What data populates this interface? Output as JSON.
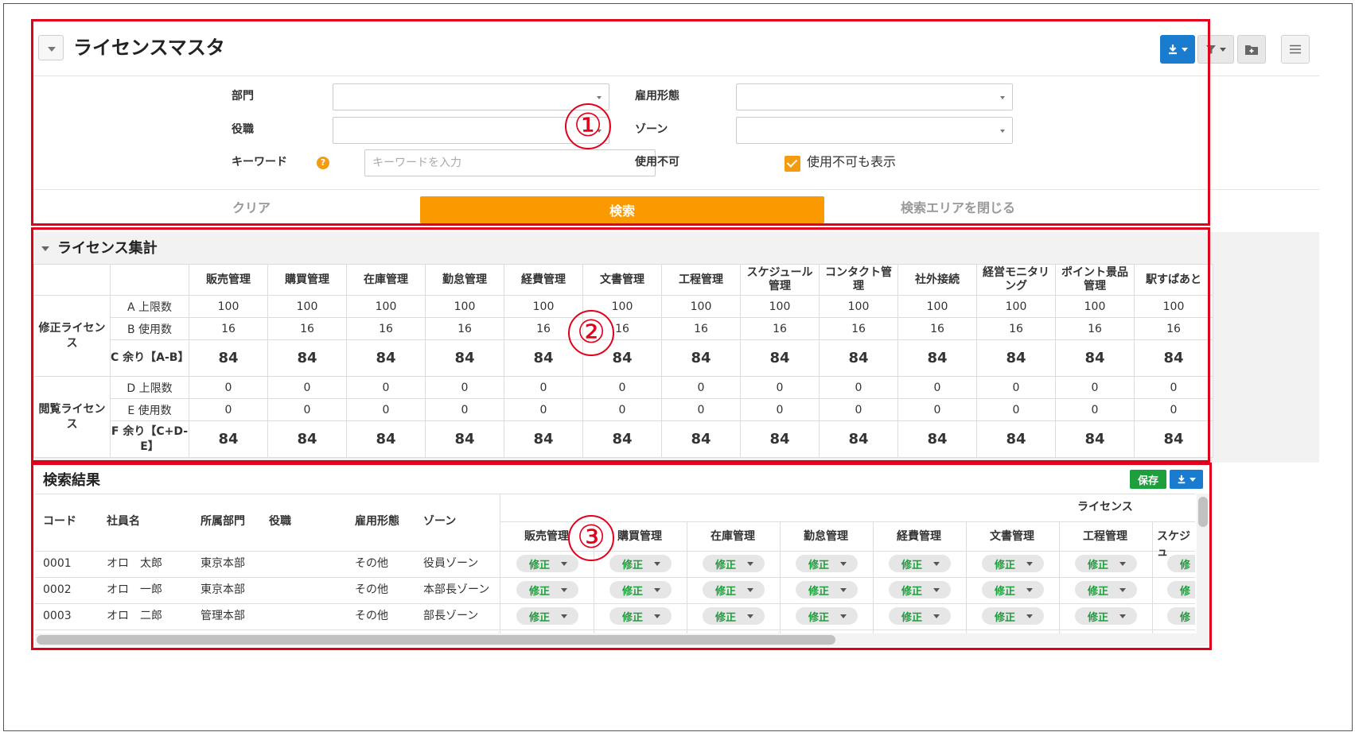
{
  "header": {
    "title": "ライセンスマスタ",
    "icons": [
      "chevron-down-icon",
      "download-icon",
      "filter-icon",
      "folder-plus-icon",
      "menu-icon"
    ]
  },
  "search_form": {
    "department_label": "部門",
    "position_label": "役職",
    "keyword_label": "キーワード",
    "keyword_placeholder": "キーワードを入力",
    "employment_label": "雇用形態",
    "zone_label": "ゾーン",
    "disabled_label": "使用不可",
    "show_disabled_label": "使用不可も表示",
    "show_disabled_checked": true,
    "clear_label": "クリア",
    "search_label": "検索",
    "close_label": "検索エリアを閉じる"
  },
  "callouts": [
    "①",
    "②",
    "③"
  ],
  "summary": {
    "title": "ライセンス集計",
    "columns": [
      "販売管理",
      "購買管理",
      "在庫管理",
      "勤怠管理",
      "経費管理",
      "文書管理",
      "工程管理",
      "スケジュール管理",
      "コンタクト管理",
      "社外接続",
      "経営モニタリング",
      "ポイント景品管理",
      "駅すぱあと"
    ],
    "groups": [
      {
        "name": "修正ライセンス",
        "rows": [
          {
            "label": "A 上限数",
            "values": [
              "100",
              "100",
              "100",
              "100",
              "100",
              "100",
              "100",
              "100",
              "100",
              "100",
              "100",
              "100",
              "100"
            ]
          },
          {
            "label": "B 使用数",
            "values": [
              "16",
              "16",
              "16",
              "16",
              "16",
              "16",
              "16",
              "16",
              "16",
              "16",
              "16",
              "16",
              "16"
            ]
          },
          {
            "label": "C 余り【A-B】",
            "values": [
              "84",
              "84",
              "84",
              "84",
              "84",
              "84",
              "84",
              "84",
              "84",
              "84",
              "84",
              "84",
              "84"
            ]
          }
        ]
      },
      {
        "name": "閲覧ライセンス",
        "rows": [
          {
            "label": "D 上限数",
            "values": [
              "0",
              "0",
              "0",
              "0",
              "0",
              "0",
              "0",
              "0",
              "0",
              "0",
              "0",
              "0",
              "0"
            ]
          },
          {
            "label": "E 使用数",
            "values": [
              "0",
              "0",
              "0",
              "0",
              "0",
              "0",
              "0",
              "0",
              "0",
              "0",
              "0",
              "0",
              "0"
            ]
          },
          {
            "label": "F 余り【C+D-E】",
            "values": [
              "84",
              "84",
              "84",
              "84",
              "84",
              "84",
              "84",
              "84",
              "84",
              "84",
              "84",
              "84",
              "84"
            ]
          }
        ]
      }
    ]
  },
  "results": {
    "title": "検索結果",
    "save_label": "保存",
    "headers": {
      "code": "コード",
      "name": "社員名",
      "dept": "所属部門",
      "position": "役職",
      "employment": "雇用形態",
      "zone": "ゾーン",
      "license_group": "ライセンス"
    },
    "license_columns": [
      "販売管理",
      "購買管理",
      "在庫管理",
      "勤怠管理",
      "経費管理",
      "文書管理",
      "工程管理",
      "スケジュ"
    ],
    "rows": [
      {
        "code": "0001",
        "name": "オロ　太郎",
        "dept": "東京本部",
        "position": "",
        "employment": "その他",
        "zone": "役員ゾーン"
      },
      {
        "code": "0002",
        "name": "オロ　一郎",
        "dept": "東京本部",
        "position": "",
        "employment": "その他",
        "zone": "本部長ゾーン"
      },
      {
        "code": "0003",
        "name": "オロ　二郎",
        "dept": "管理本部",
        "position": "",
        "employment": "その他",
        "zone": "部長ゾーン"
      }
    ],
    "cell_value": "修正",
    "cell_value_clipped": "修"
  },
  "colors": {
    "primary": "#1a7ccf",
    "accent": "#fb9a00",
    "success": "#1d9f3c",
    "highlight": "#e2001a"
  }
}
